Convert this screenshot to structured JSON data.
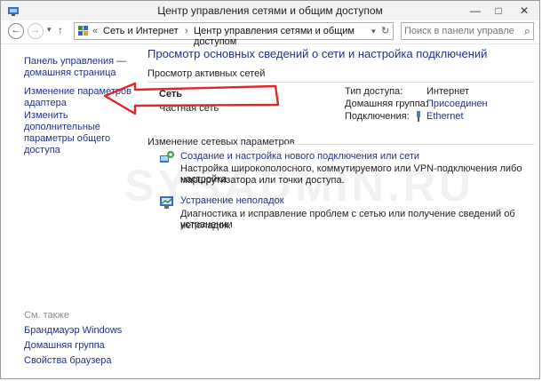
{
  "window": {
    "title": "Центр управления сетями и общим доступом",
    "minimize": "—",
    "maximize": "□",
    "close": "✕"
  },
  "nav": {
    "back": "←",
    "forward": "→",
    "up": "↑",
    "breadcrumb_sep": "«",
    "crumb1": "Сеть и Интернет",
    "arrow1": "›",
    "crumb2": "Центр управления сетями и общим доступом",
    "dropdown": "▾",
    "refresh": "↻",
    "search_placeholder": "Поиск в панели управления",
    "search_icon": "⌕"
  },
  "sidebar": {
    "home_1": "Панель управления —",
    "home_2": "домашняя страница",
    "adapter_1": "Изменение параметров",
    "adapter_2": "адаптера",
    "sharing_1": "Изменить дополнительные",
    "sharing_2": "параметры общего доступа",
    "see_also": "См. также",
    "firewall": "Брандмауэр Windows",
    "homegroup": "Домашняя группа",
    "browser": "Свойства браузера"
  },
  "main": {
    "heading": "Просмотр основных сведений о сети и настройка подключений",
    "active_title": "Просмотр активных сетей",
    "network_name": "Сеть",
    "network_type": "Частная сеть",
    "access_label": "Тип доступа:",
    "access_value": "Интернет",
    "homegroup_label": "Домашняя группа:",
    "homegroup_value": "Присоединен",
    "conn_label": "Подключения:",
    "conn_value": "Ethernet",
    "change_title": "Изменение сетевых параметров",
    "setup_link": "Создание и настройка нового подключения или сети",
    "setup_desc_1": "Настройка широкополосного, коммутируемого или VPN-подключения либо настройка",
    "setup_desc_2": "маршрутизатора или точки доступа.",
    "trouble_link": "Устранение неполадок",
    "trouble_desc_1": "Диагностика и исправление проблем с сетью или получение сведений об устранении",
    "trouble_desc_2": "неполадок."
  },
  "watermark": "SYSADMIN.RU",
  "colors": {
    "link": "#1e3287",
    "annotation_arrow": "#e0262b",
    "titlebar": "#f2f2f2"
  }
}
